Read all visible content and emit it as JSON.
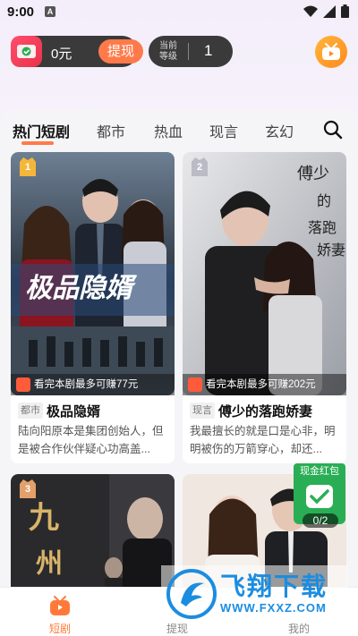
{
  "status_bar": {
    "time": "9:00",
    "notification": "A"
  },
  "header": {
    "wallet_amount": "0元",
    "withdraw_label": "提现",
    "level_label": "当前等级",
    "level_value": "1"
  },
  "tabs": [
    {
      "label": "热门短剧",
      "active": true
    },
    {
      "label": "都市"
    },
    {
      "label": "热血"
    },
    {
      "label": "现言"
    },
    {
      "label": "玄幻"
    }
  ],
  "cards": [
    {
      "rank": "1",
      "earn": "看完本剧最多可赚77元",
      "genre": "都市",
      "title": "极品隐婿",
      "desc": "陆向阳原本是集团创始人，但是被合作伙伴疑心功高盖..."
    },
    {
      "rank": "2",
      "earn": "看完本剧最多可赚202元",
      "genre": "现言",
      "title": "傅少的落跑娇妻",
      "desc": "我最擅长的就是口是心非，明明被伤的万箭穿心，却还..."
    },
    {
      "rank": "3"
    },
    {}
  ],
  "cash_widget": {
    "label": "现金红包",
    "counter": "0/2"
  },
  "bottom_nav": [
    {
      "label": "短剧",
      "active": true
    },
    {
      "label": "提现"
    },
    {
      "label": "我的"
    }
  ],
  "watermark": {
    "brand": "飞翔下载",
    "url": "WWW.FXXZ.COM"
  },
  "colors": {
    "accent": "#ff7a4a",
    "dark_pill": "#3a3a3a",
    "green": "#2aae55"
  }
}
